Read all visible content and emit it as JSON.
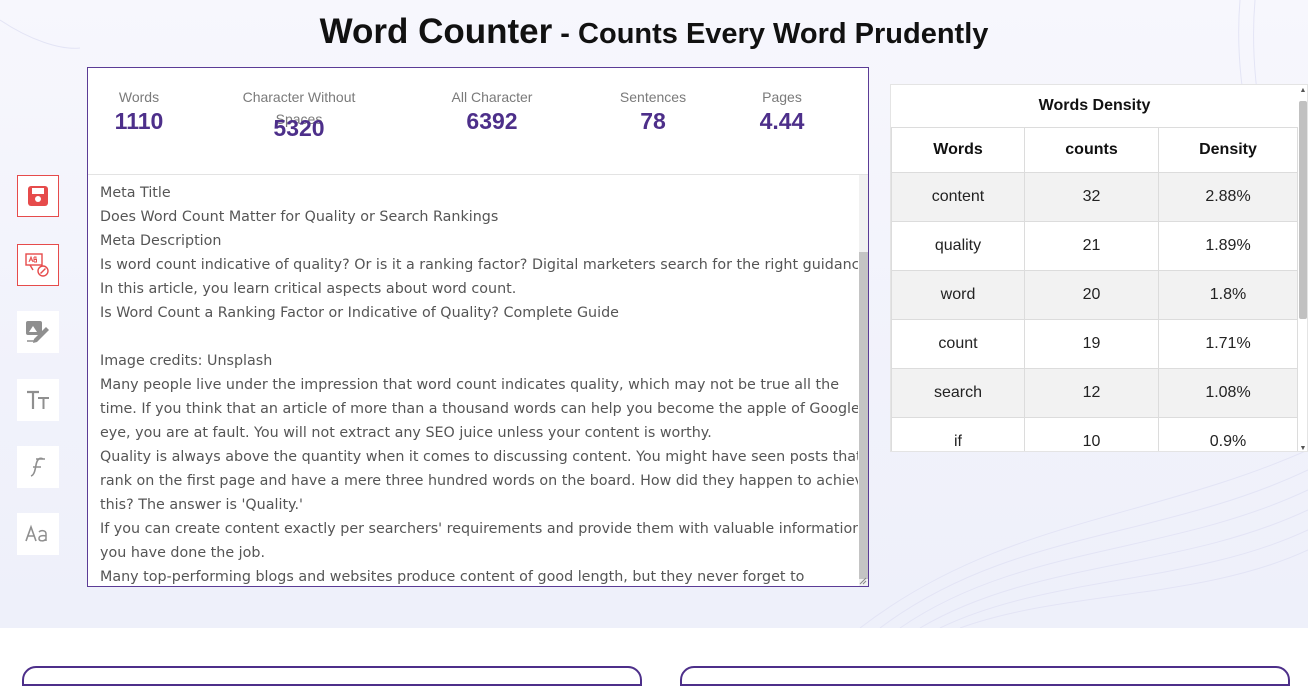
{
  "title": {
    "main": "Word Counter",
    "separator": " - ",
    "subtitle": "Counts Every Word Prudently"
  },
  "sidebar": {
    "buttons": [
      {
        "name": "save-icon"
      },
      {
        "name": "spell-check-icon"
      },
      {
        "name": "image-text-icon"
      },
      {
        "name": "text-size-icon"
      },
      {
        "name": "font-style-icon"
      },
      {
        "name": "case-change-icon"
      }
    ]
  },
  "stats": {
    "words": {
      "label": "Words",
      "value": "1110"
    },
    "chars_no_spaces": {
      "label": "Character Without Spaces",
      "value": "5320"
    },
    "all_chars": {
      "label": "All Character",
      "value": "6392"
    },
    "sentences": {
      "label": "Sentences",
      "value": "78"
    },
    "pages": {
      "label": "Pages",
      "value": "4.44"
    }
  },
  "editor": {
    "lines": [
      "Meta Title",
      "Does Word Count Matter for Quality or Search Rankings",
      "Meta Description",
      "Is word count indicative of quality? Or is it a ranking factor? Digital marketers search for the right guidance.",
      "In this article, you learn critical aspects about word count.",
      "Is Word Count a Ranking Factor or Indicative of Quality? Complete Guide",
      "",
      "Image credits: Unsplash",
      "Many people live under the impression that word count indicates quality, which may not be true all the",
      "time. If you think that an article of more than a thousand words can help you become the apple of Google's",
      "eye, you are at fault. You will not extract any SEO juice unless your content is worthy.",
      "Quality is always above the quantity when it comes to discussing content. You might have seen posts that",
      "rank on the first page and have a mere three hundred words on the board. How did they happen to achieve",
      "this? The answer is 'Quality.'",
      "If you can create content exactly per searchers' requirements and provide them with valuable information,",
      "you have done the job.",
      "Many top-performing blogs and websites produce content of good length, but they never forget to"
    ]
  },
  "density": {
    "title": "Words Density",
    "headers": {
      "word": "Words",
      "count": "counts",
      "density": "Density"
    },
    "rows": [
      {
        "word": "content",
        "count": "32",
        "density": "2.88%"
      },
      {
        "word": "quality",
        "count": "21",
        "density": "1.89%"
      },
      {
        "word": "word",
        "count": "20",
        "density": "1.8%"
      },
      {
        "word": "count",
        "count": "19",
        "density": "1.71%"
      },
      {
        "word": "search",
        "count": "12",
        "density": "1.08%"
      },
      {
        "word": "if",
        "count": "10",
        "density": "0.9%"
      }
    ]
  },
  "colors": {
    "accent": "#4d2f8a",
    "danger": "#e64b4b"
  }
}
